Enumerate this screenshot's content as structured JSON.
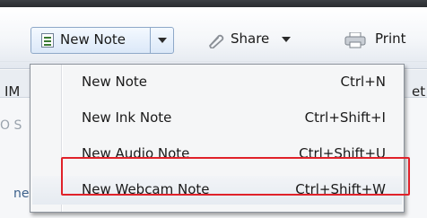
{
  "toolbar": {
    "new_note_label": "New Note",
    "share_label": "Share",
    "print_label": "Print",
    "icons": [
      "note-icon",
      "share-icon",
      "print-icon"
    ]
  },
  "background_fragments": {
    "left_tab": "IM",
    "right_tab": "et",
    "search_hint": "O S",
    "note_text": "ne"
  },
  "menu": {
    "items": [
      {
        "label": "New Note",
        "shortcut": "Ctrl+N"
      },
      {
        "label": "New Ink Note",
        "shortcut": "Ctrl+Shift+I"
      },
      {
        "label": "New Audio Note",
        "shortcut": "Ctrl+Shift+U"
      },
      {
        "label": "New Webcam Note",
        "shortcut": "Ctrl+Shift+W"
      }
    ]
  },
  "colors": {
    "highlight_border": "#e0222a",
    "split_button_border": "#8ea8c8"
  }
}
